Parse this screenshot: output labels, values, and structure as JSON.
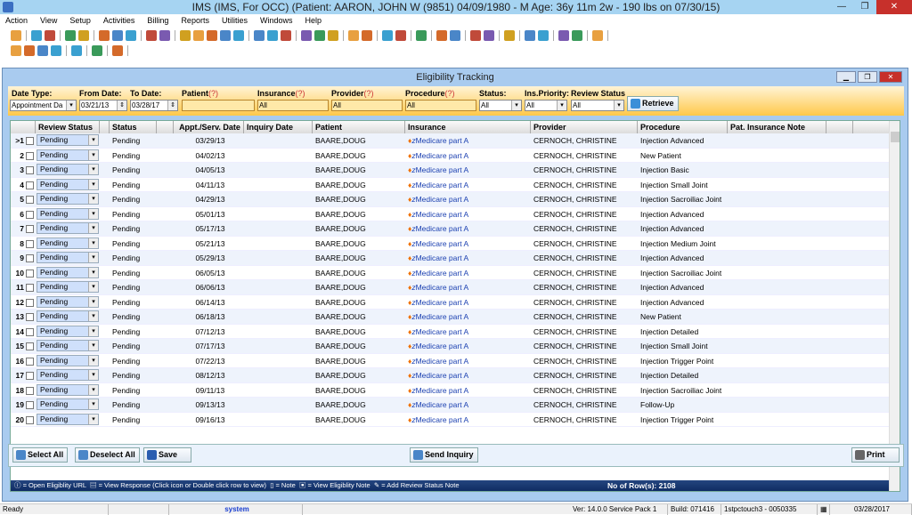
{
  "window": {
    "title": "IMS (IMS, For OCC)    (Patient: AARON, JOHN W (9851) 04/09/1980 - M Age: 36y 11m 2w - 190 lbs on 07/30/15)"
  },
  "menu": [
    "Action",
    "View",
    "Setup",
    "Activities",
    "Billing",
    "Reports",
    "Utilities",
    "Windows",
    "Help"
  ],
  "child": {
    "title": "Eligibility Tracking"
  },
  "filters": {
    "date_type": {
      "label": "Date Type:",
      "value": "Appointment Da"
    },
    "from_date": {
      "label": "From Date:",
      "value": "03/21/13"
    },
    "to_date": {
      "label": "To Date:",
      "value": "03/28/17"
    },
    "patient": {
      "label": "Patient",
      "hint": "(?)",
      "value": ""
    },
    "insurance": {
      "label": "Insurance",
      "hint": "(?)",
      "value": "All"
    },
    "provider": {
      "label": "Provider",
      "hint": "(?)",
      "value": "All"
    },
    "procedure": {
      "label": "Procedure",
      "hint": "(?)",
      "value": "All"
    },
    "status": {
      "label": "Status:",
      "value": "All"
    },
    "ins_priority": {
      "label": "Ins.Priority:",
      "value": "All"
    },
    "review_status": {
      "label": "Review Status",
      "value": "All"
    },
    "retrieve": "Retrieve"
  },
  "columns": [
    "Review Status",
    "Status",
    "Appt./Serv. Date",
    "Inquiry Date",
    "Patient",
    "Insurance",
    "Provider",
    "Procedure",
    "Pat. Insurance Note"
  ],
  "rows": [
    {
      "n": "1",
      "rs": "Pending",
      "st": "Pending",
      "d": "03/29/13",
      "p": "BAARE,DOUG",
      "i": "Medicare part A",
      "pr": "CERNOCH, CHRISTINE",
      "proc": "Injection Advanced"
    },
    {
      "n": "2",
      "rs": "Pending",
      "st": "Pending",
      "d": "04/02/13",
      "p": "BAARE,DOUG",
      "i": "Medicare part A",
      "pr": "CERNOCH, CHRISTINE",
      "proc": "New Patient"
    },
    {
      "n": "3",
      "rs": "Pending",
      "st": "Pending",
      "d": "04/05/13",
      "p": "BAARE,DOUG",
      "i": "Medicare part A",
      "pr": "CERNOCH, CHRISTINE",
      "proc": "Injection Basic"
    },
    {
      "n": "4",
      "rs": "Pending",
      "st": "Pending",
      "d": "04/11/13",
      "p": "BAARE,DOUG",
      "i": "Medicare part A",
      "pr": "CERNOCH, CHRISTINE",
      "proc": "Injection Small Joint"
    },
    {
      "n": "5",
      "rs": "Pending",
      "st": "Pending",
      "d": "04/29/13",
      "p": "BAARE,DOUG",
      "i": "Medicare part A",
      "pr": "CERNOCH, CHRISTINE",
      "proc": "Injection Sacroiliac Joint"
    },
    {
      "n": "6",
      "rs": "Pending",
      "st": "Pending",
      "d": "05/01/13",
      "p": "BAARE,DOUG",
      "i": "Medicare part A",
      "pr": "CERNOCH, CHRISTINE",
      "proc": "Injection Advanced"
    },
    {
      "n": "7",
      "rs": "Pending",
      "st": "Pending",
      "d": "05/17/13",
      "p": "BAARE,DOUG",
      "i": "Medicare part A",
      "pr": "CERNOCH, CHRISTINE",
      "proc": "Injection Advanced"
    },
    {
      "n": "8",
      "rs": "Pending",
      "st": "Pending",
      "d": "05/21/13",
      "p": "BAARE,DOUG",
      "i": "Medicare part A",
      "pr": "CERNOCH, CHRISTINE",
      "proc": "Injection Medium Joint"
    },
    {
      "n": "9",
      "rs": "Pending",
      "st": "Pending",
      "d": "05/29/13",
      "p": "BAARE,DOUG",
      "i": "Medicare part A",
      "pr": "CERNOCH, CHRISTINE",
      "proc": "Injection Advanced"
    },
    {
      "n": "10",
      "rs": "Pending",
      "st": "Pending",
      "d": "06/05/13",
      "p": "BAARE,DOUG",
      "i": "Medicare part A",
      "pr": "CERNOCH, CHRISTINE",
      "proc": "Injection Sacroiliac Joint"
    },
    {
      "n": "11",
      "rs": "Pending",
      "st": "Pending",
      "d": "06/06/13",
      "p": "BAARE,DOUG",
      "i": "Medicare part A",
      "pr": "CERNOCH, CHRISTINE",
      "proc": "Injection Advanced"
    },
    {
      "n": "12",
      "rs": "Pending",
      "st": "Pending",
      "d": "06/14/13",
      "p": "BAARE,DOUG",
      "i": "Medicare part A",
      "pr": "CERNOCH, CHRISTINE",
      "proc": "Injection Advanced"
    },
    {
      "n": "13",
      "rs": "Pending",
      "st": "Pending",
      "d": "06/18/13",
      "p": "BAARE,DOUG",
      "i": "Medicare part A",
      "pr": "CERNOCH, CHRISTINE",
      "proc": "New Patient"
    },
    {
      "n": "14",
      "rs": "Pending",
      "st": "Pending",
      "d": "07/12/13",
      "p": "BAARE,DOUG",
      "i": "Medicare part A",
      "pr": "CERNOCH, CHRISTINE",
      "proc": "Injection Detailed"
    },
    {
      "n": "15",
      "rs": "Pending",
      "st": "Pending",
      "d": "07/17/13",
      "p": "BAARE,DOUG",
      "i": "Medicare part A",
      "pr": "CERNOCH, CHRISTINE",
      "proc": "Injection Small Joint"
    },
    {
      "n": "16",
      "rs": "Pending",
      "st": "Pending",
      "d": "07/22/13",
      "p": "BAARE,DOUG",
      "i": "Medicare part A",
      "pr": "CERNOCH, CHRISTINE",
      "proc": "Injection Trigger Point"
    },
    {
      "n": "17",
      "rs": "Pending",
      "st": "Pending",
      "d": "08/12/13",
      "p": "BAARE,DOUG",
      "i": "Medicare part A",
      "pr": "CERNOCH, CHRISTINE",
      "proc": "Injection Detailed"
    },
    {
      "n": "18",
      "rs": "Pending",
      "st": "Pending",
      "d": "09/11/13",
      "p": "BAARE,DOUG",
      "i": "Medicare part A",
      "pr": "CERNOCH, CHRISTINE",
      "proc": "Injection Sacroiliac Joint"
    },
    {
      "n": "19",
      "rs": "Pending",
      "st": "Pending",
      "d": "09/13/13",
      "p": "BAARE,DOUG",
      "i": "Medicare part A",
      "pr": "CERNOCH, CHRISTINE",
      "proc": "Follow-Up"
    },
    {
      "n": "20",
      "rs": "Pending",
      "st": "Pending",
      "d": "09/16/13",
      "p": "BAARE,DOUG",
      "i": "Medicare part A",
      "pr": "CERNOCH, CHRISTINE",
      "proc": "Injection Trigger Point"
    }
  ],
  "legend": {
    "url": "= Open Eligiblity URL",
    "resp": "= View Response (Click icon or Double click row to view)",
    "note": "= Note",
    "elig": "= View Eligiblity Note",
    "add": "= Add Review Status Note",
    "count": "No of Row(s): 2108"
  },
  "buttons": {
    "select_all": "Select All",
    "deselect_all": "Deselect All",
    "save": "Save",
    "send": "Send Inquiry",
    "print": "Print"
  },
  "status": {
    "ready": "Ready",
    "user": "system",
    "version": "Ver: 14.0.0 Service Pack 1",
    "build": "Build: 071416",
    "server": "1stpctouch3 - 0050335",
    "date": "03/28/2017"
  }
}
